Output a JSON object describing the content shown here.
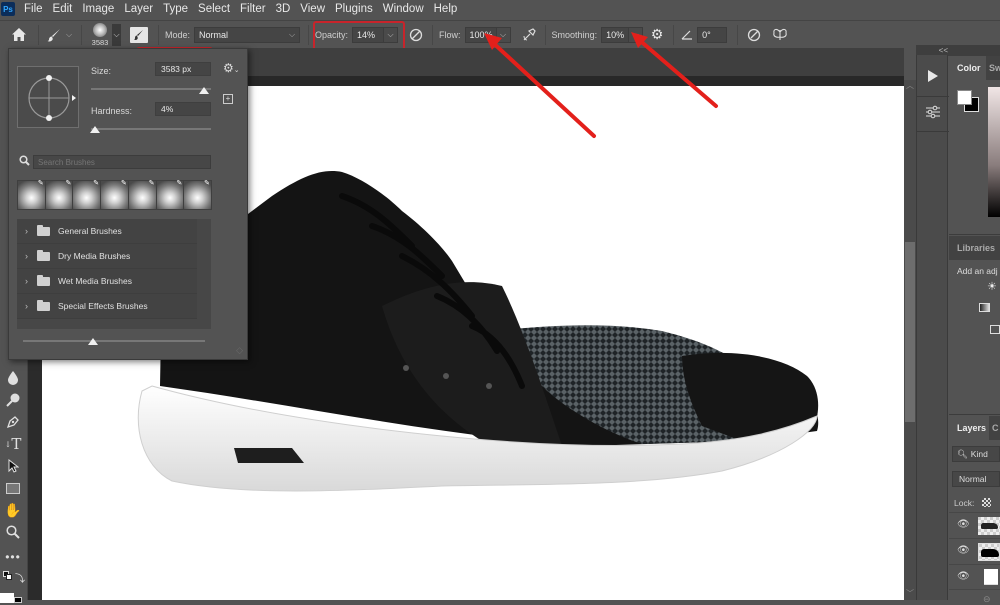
{
  "app": {
    "logo": "Ps",
    "menu": [
      "File",
      "Edit",
      "Image",
      "Layer",
      "Type",
      "Select",
      "Filter",
      "3D",
      "View",
      "Plugins",
      "Window",
      "Help"
    ]
  },
  "options_bar": {
    "brush_size_label": "3583",
    "mode_label": "Mode:",
    "mode_value": "Normal",
    "opacity_label": "Opacity:",
    "opacity_value": "14%",
    "flow_label": "Flow:",
    "flow_value": "100%",
    "smoothing_label": "Smoothing:",
    "smoothing_value": "10%",
    "angle_value": "0°",
    "icons": [
      "home-icon",
      "brush-tool-icon",
      "brush-preset-icon",
      "brush-settings-icon",
      "pressure-opacity-icon",
      "airbrush-icon",
      "smoothing-settings-icon",
      "angle-icon",
      "pressure-size-icon",
      "symmetry-icon"
    ]
  },
  "brush_popup": {
    "size_label": "Size:",
    "size_value": "3583 px",
    "size_slider_fraction": 0.86,
    "hardness_label": "Hardness:",
    "hardness_value": "4%",
    "hardness_slider_fraction": 0.04,
    "search_placeholder": "Search Brushes",
    "preset_count": 7,
    "folders": [
      {
        "label": "General Brushes"
      },
      {
        "label": "Dry Media Brushes"
      },
      {
        "label": "Wet Media Brushes"
      },
      {
        "label": "Special Effects Brushes"
      }
    ],
    "preview_size_fraction": 0.42
  },
  "toolbar": {
    "tools": [
      "blur-tool-icon",
      "dodge-tool-icon",
      "pen-tool-icon",
      "type-tool-icon",
      "path-selection-icon",
      "rectangle-tool-icon",
      "hand-tool-icon",
      "zoom-tool-icon",
      "more-tools-icon",
      "default-colors-icon"
    ]
  },
  "right_panel": {
    "collapse": "<<",
    "color_tab": "Color",
    "swatches_tab": "Sw",
    "libraries_tab": "Libraries",
    "adjustments_text": "Add an adj",
    "layers_tab": "Layers",
    "channels_tab": "C",
    "kind_filter": "Kind",
    "blend_mode": "Normal",
    "lock_label": "Lock:",
    "foreground_color": "#ffffff",
    "background_color": "#000000"
  },
  "annotations": {
    "highlight_color": "#c8242b",
    "arrow_color": "#e3201b"
  }
}
